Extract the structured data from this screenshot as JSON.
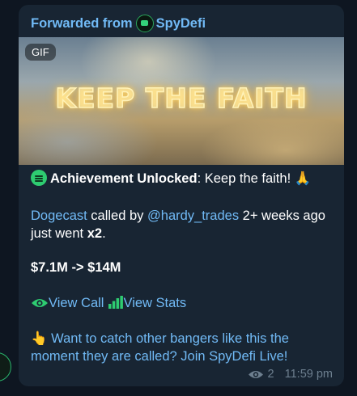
{
  "forward": {
    "prefix": "Forwarded from",
    "channel": "SpyDefi"
  },
  "media": {
    "badge": "GIF",
    "overlay_text": "KEEP THE FAITH"
  },
  "achievement": {
    "title": "Achievement Unlocked",
    "separator": ":",
    "text": " Keep the faith! ",
    "emoji": "🙏"
  },
  "call": {
    "token": "Dogecast",
    "called_by": " called by ",
    "caller": "@hardy_trades",
    "time_text": " 2+ weeks ago",
    "line2_prefix": "just went ",
    "multiplier": "x2",
    "line2_suffix": "."
  },
  "market_cap": "$7.1M -> $14M",
  "actions": {
    "view_call": "View Call",
    "view_stats": "View Stats"
  },
  "promo": {
    "emoji": "👆",
    "line1": " Want to catch other bangers like this the",
    "line2": "moment they are called? Join SpyDefi Live!"
  },
  "meta": {
    "views": "2",
    "time": "11:59 pm"
  },
  "colors": {
    "background": "#0e1621",
    "bubble": "#182533",
    "link": "#71baf6",
    "accent_green": "#2ecc71",
    "meta": "#6d7f8f"
  }
}
